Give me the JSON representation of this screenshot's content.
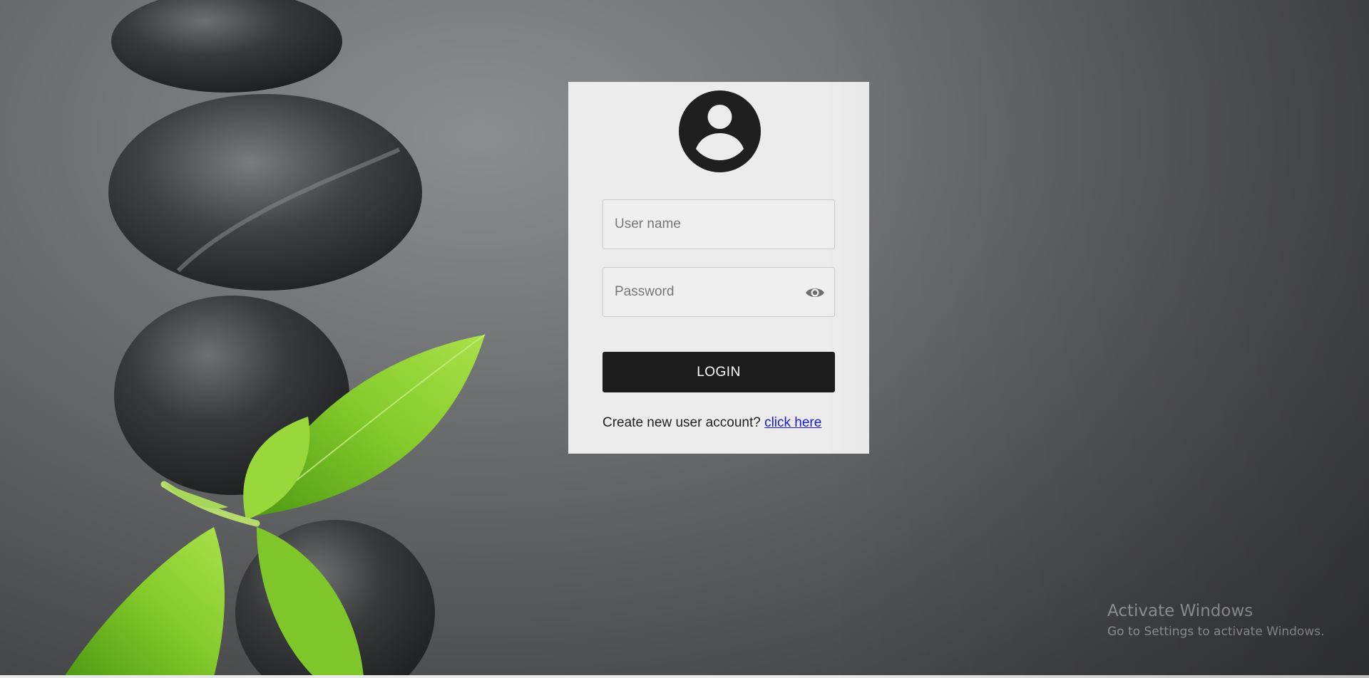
{
  "background": {
    "colors": {
      "surface": "#77787a",
      "stone": "#2b2c2e",
      "leaf": "#7fc62a"
    }
  },
  "login_card": {
    "avatar_icon": "user-circle-icon",
    "username": {
      "placeholder": "User name",
      "value": ""
    },
    "password": {
      "placeholder": "Password",
      "value": "",
      "toggle_icon": "eye-icon"
    },
    "login_button_label": "LOGIN",
    "create_account_text": "Create new user account?",
    "create_account_link": "click here",
    "colors": {
      "card_bg": "#ececec",
      "button_bg": "#1c1c1c",
      "link": "#1a1ad6"
    }
  },
  "watermark": {
    "title": "Activate Windows",
    "subtitle": "Go to Settings to activate Windows."
  }
}
